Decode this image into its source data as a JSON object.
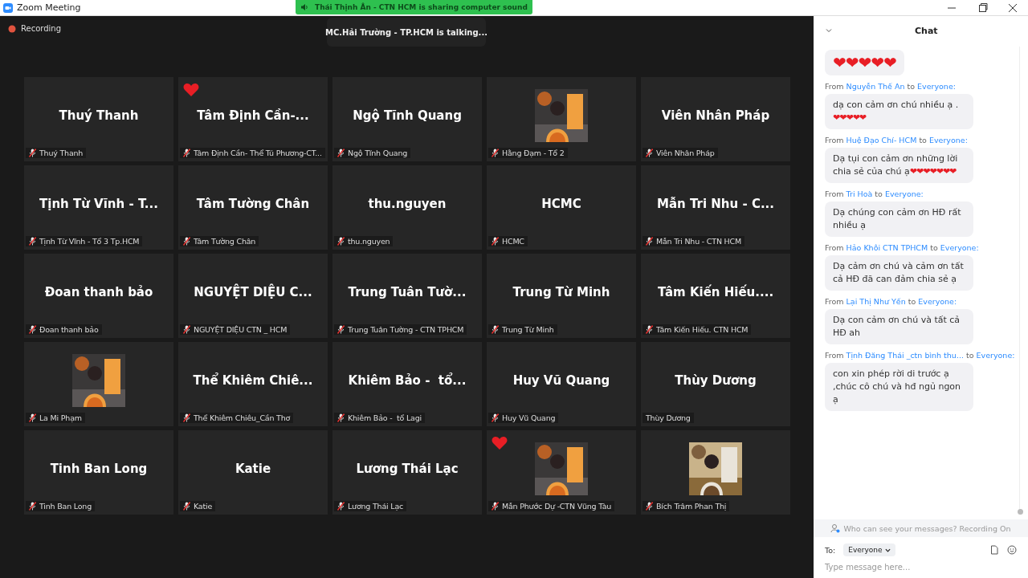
{
  "window": {
    "title": "Zoom Meeting"
  },
  "sharing_banner": "Thái Thịnh Ân - CTN HCM is sharing computer sound",
  "recording": "Recording",
  "talking": "MC.Hải Trường - TP.HCM is talking...",
  "tiles": [
    {
      "kind": "name",
      "display": "Thuý Thanh",
      "label": "Thuý Thanh",
      "muted": true,
      "reaction": false
    },
    {
      "kind": "name",
      "display": "Tâm Định Cần-...",
      "label": "Tâm Định Cần- Thể Tú Phương-CT...",
      "muted": true,
      "reaction": true
    },
    {
      "kind": "name",
      "display": "Ngộ Tĩnh Quang",
      "label": "Ngộ Tĩnh Quang",
      "muted": true,
      "reaction": false
    },
    {
      "kind": "picture",
      "label": "Hằng Đạm - Tổ 2",
      "muted": true,
      "reaction": false
    },
    {
      "kind": "name",
      "display": "Viên Nhân Pháp",
      "label": "Viên Nhân Pháp",
      "muted": true,
      "reaction": false
    },
    {
      "kind": "name",
      "display": "Tịnh Từ Vĩnh - T...",
      "label": "Tịnh Từ Vĩnh - Tổ 3 Tp.HCM",
      "muted": true,
      "reaction": false
    },
    {
      "kind": "name",
      "display": "Tâm Tường Chân",
      "label": "Tâm Tường Chân",
      "muted": true,
      "reaction": false
    },
    {
      "kind": "name",
      "display": "thu.nguyen",
      "label": "thu.nguyen",
      "muted": true,
      "reaction": false
    },
    {
      "kind": "name",
      "display": "HCMC",
      "label": "HCMC",
      "muted": true,
      "reaction": false
    },
    {
      "kind": "name",
      "display": "Mẫn Tri Nhu - C...",
      "label": "Mẫn Tri Nhu - CTN HCM",
      "muted": true,
      "reaction": false
    },
    {
      "kind": "name",
      "display": "Đoan thanh bảo",
      "label": "Đoan thanh bảo",
      "muted": true,
      "reaction": false
    },
    {
      "kind": "name",
      "display": "NGUYỆT DIỆU C...",
      "label": "NGUYỆT DIỆU CTN _ HCM",
      "muted": true,
      "reaction": false
    },
    {
      "kind": "name",
      "display": "Trung Tuân Tườ...",
      "label": "Trung Tuân Tường - CTN TPHCM",
      "muted": true,
      "reaction": false
    },
    {
      "kind": "name",
      "display": "Trung Từ Minh",
      "label": "Trung Từ Minh",
      "muted": true,
      "reaction": false
    },
    {
      "kind": "name",
      "display": "Tâm Kiến Hiếu....",
      "label": "Tâm Kiến Hiếu. CTN HCM",
      "muted": true,
      "reaction": false
    },
    {
      "kind": "picture",
      "label": "La Mi Phạm",
      "muted": true,
      "reaction": false
    },
    {
      "kind": "name",
      "display": "Thể Khiêm Chiê...",
      "label": "Thể Khiêm Chiêu_Cần Thơ",
      "muted": true,
      "reaction": false
    },
    {
      "kind": "name",
      "display": "Khiêm Bảo -  tổ...",
      "label": "Khiêm Bảo -  tổ Lagi",
      "muted": true,
      "reaction": false
    },
    {
      "kind": "name",
      "display": "Huy Vũ Quang",
      "label": "Huy Vũ Quang",
      "muted": true,
      "reaction": false
    },
    {
      "kind": "name",
      "display": "Thùy Dương",
      "label": "Thùy Dương",
      "muted": false,
      "reaction": false
    },
    {
      "kind": "name",
      "display": "Tinh Ban Long",
      "label": "Tinh Ban Long",
      "muted": true,
      "reaction": false
    },
    {
      "kind": "name",
      "display": "Katie",
      "label": "Katie",
      "muted": true,
      "reaction": false
    },
    {
      "kind": "name",
      "display": "Lương Thái Lạc",
      "label": "Lương Thái Lạc",
      "muted": true,
      "reaction": false
    },
    {
      "kind": "picture",
      "label": "Mẫn Phước Dự -CTN Vũng Tàu",
      "muted": true,
      "reaction": true
    },
    {
      "kind": "picture",
      "label": "Bích Trâm Phan Thị",
      "muted": true,
      "reaction": false
    }
  ],
  "chat": {
    "title": "Chat",
    "messages": [
      {
        "text": "❤❤❤❤❤"
      },
      {
        "from_label": "From",
        "from": "Nguyễn Thế An",
        "to_label": "to",
        "to": "Everyone:",
        "text": "dạ con cảm ơn chú nhiều ạ . ❤❤❤❤❤"
      },
      {
        "from_label": "From",
        "from": "Huệ Đạo Chí-  HCM",
        "to_label": "to",
        "to": "Everyone:",
        "text": "Dạ tụi con cảm ơn những lời chia sẻ của chú ạ❤❤❤❤❤❤❤"
      },
      {
        "from_label": "From",
        "from": "Tri Hoà",
        "to_label": "to",
        "to": "Everyone:",
        "text": "Dạ chúng con cảm ơn HĐ rất nhiều ạ"
      },
      {
        "from_label": "From",
        "from": "Hảo Khôi CTN TPHCM",
        "to_label": "to",
        "to": "Everyone:",
        "text": "Dạ cảm ơn chú và cảm ơn tất cả HĐ đã can đảm chia sẻ ạ"
      },
      {
        "from_label": "From",
        "from": "Lại Thị Như Yến",
        "to_label": "to",
        "to": "Everyone:",
        "text": "Dạ con cảm ơn chú và tất cả HĐ ah"
      },
      {
        "from_label": "From",
        "from": "Tịnh Đăng Thái _ctn bình thu...",
        "to_label": "to",
        "to": "Everyone:",
        "text": "con xin phép rời di trước ạ ,chúc cô chú và hđ ngủ ngon ạ"
      }
    ],
    "privacy_note": "Who can see your messages? Recording On",
    "to_label": "To:",
    "recipient": "Everyone",
    "placeholder": "Type message here..."
  }
}
